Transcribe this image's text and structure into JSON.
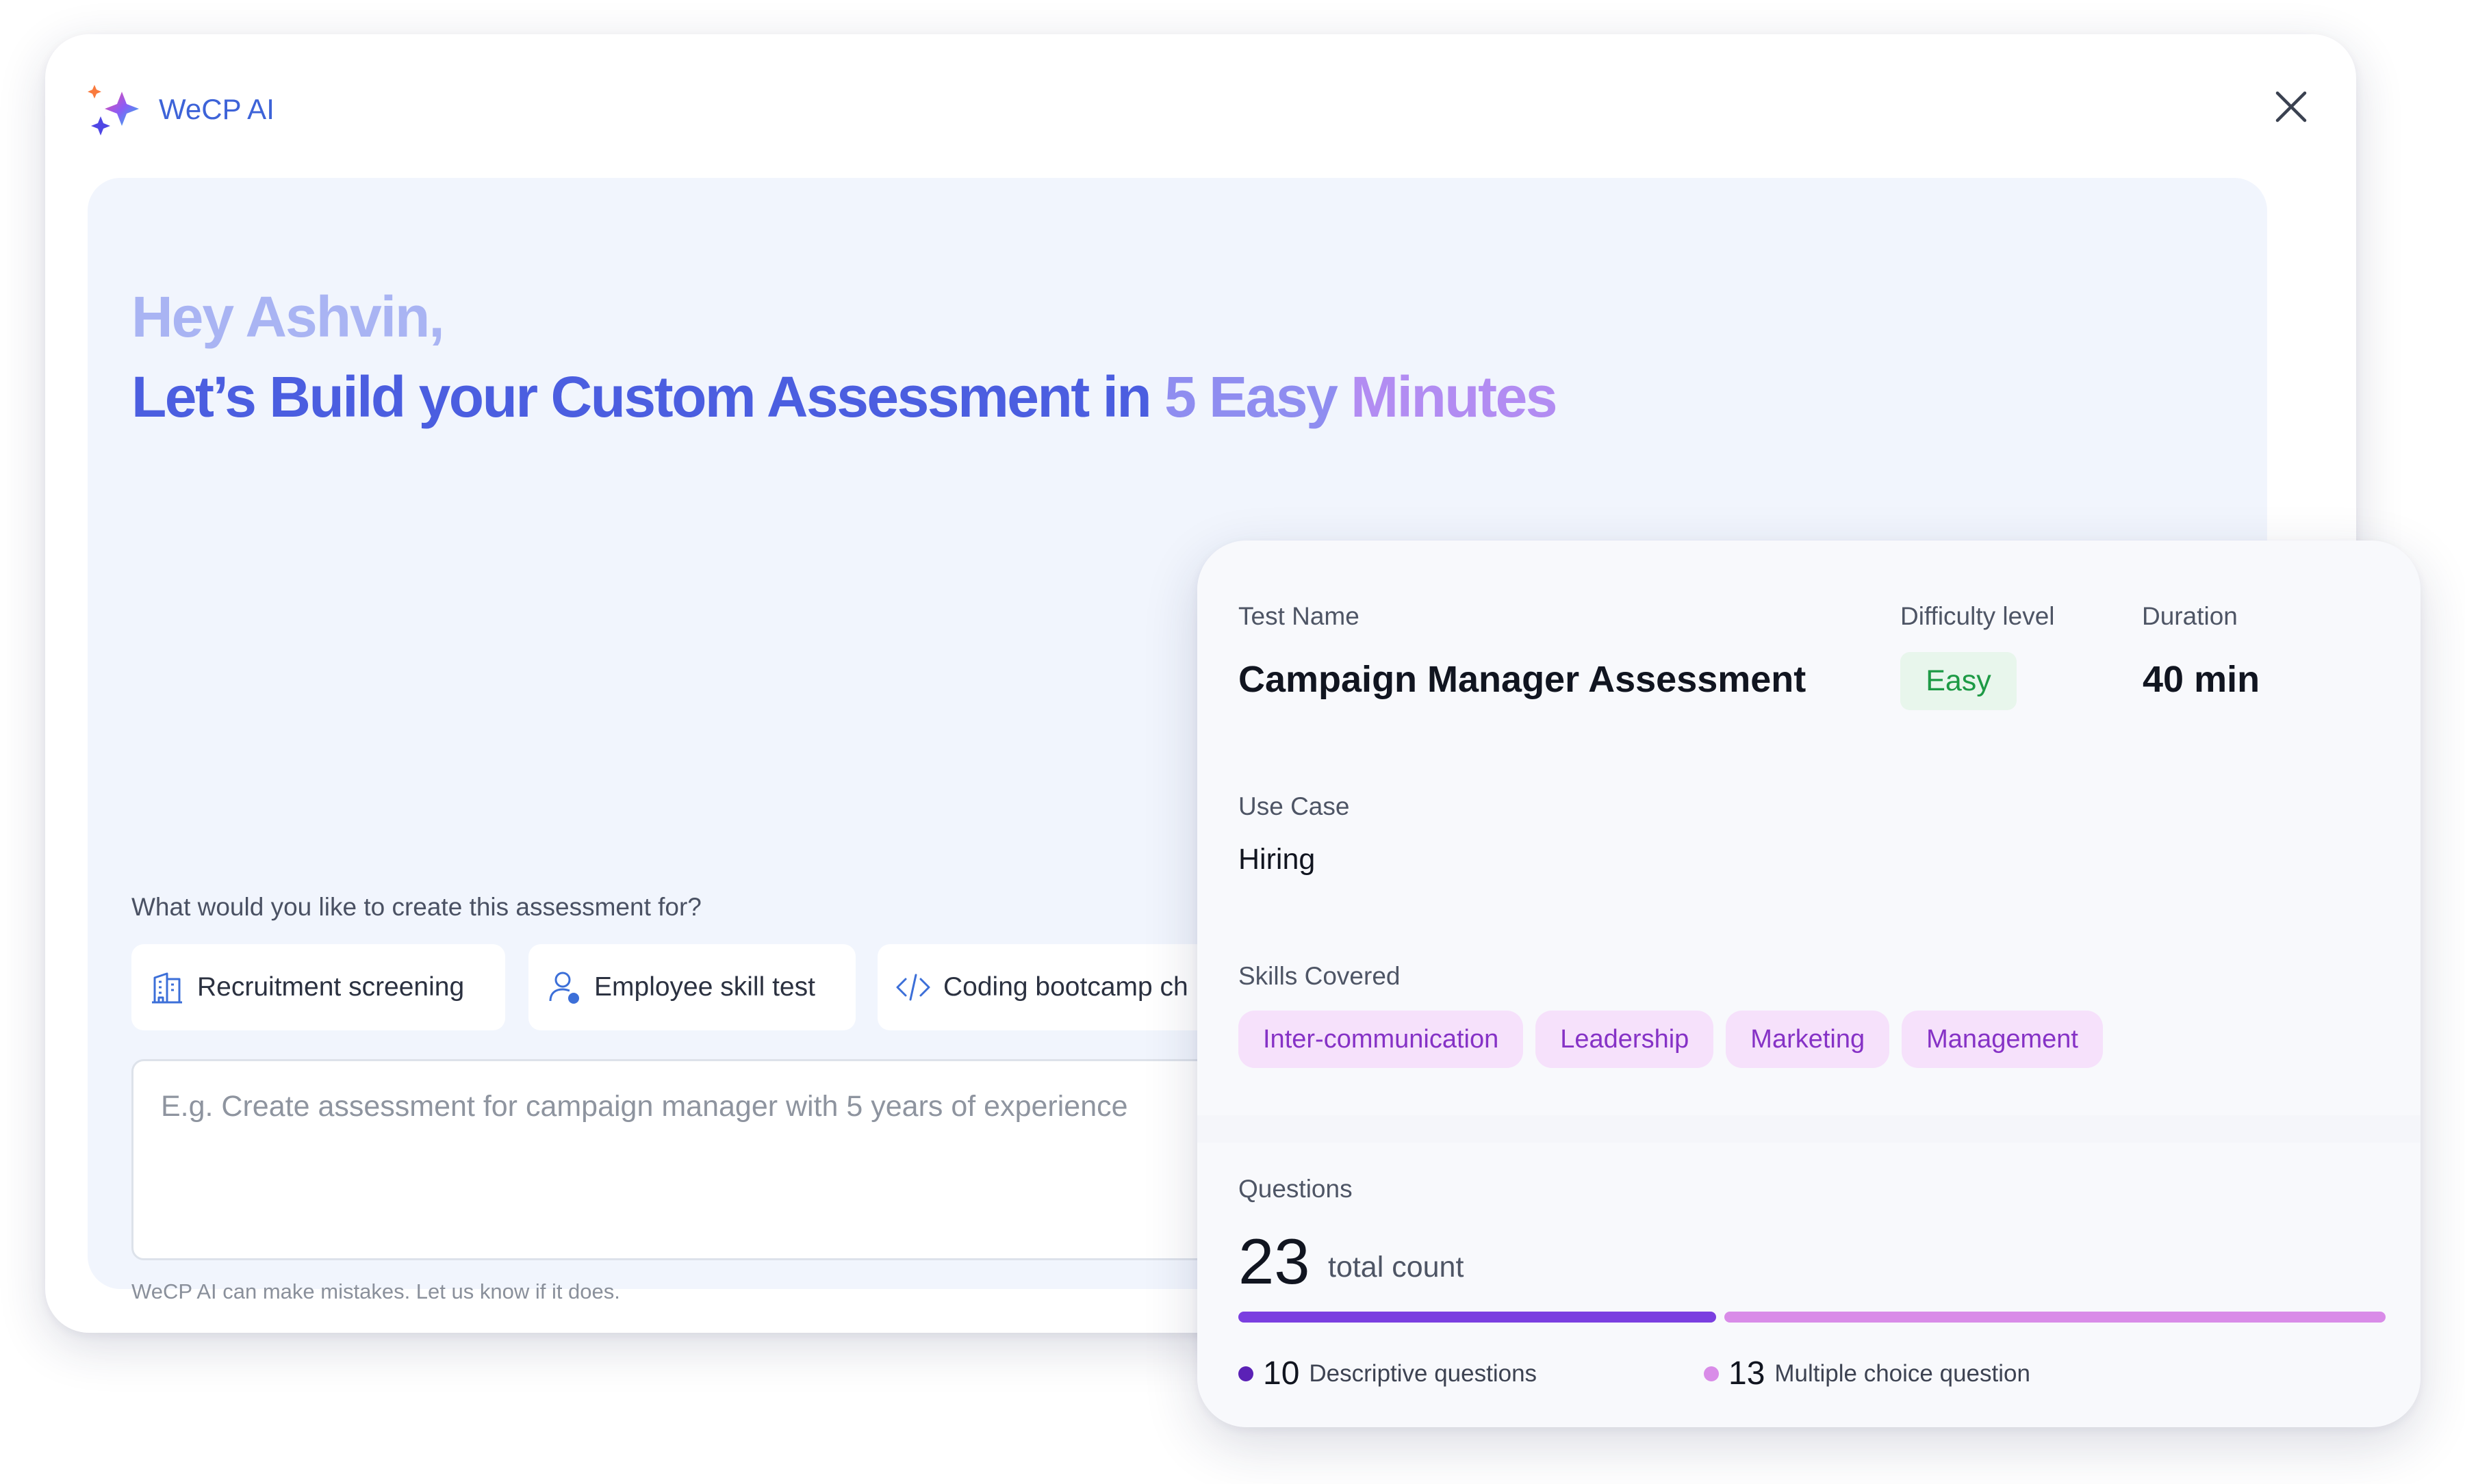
{
  "app": {
    "brand_name": "WeCP AI"
  },
  "hero": {
    "greeting": "Hey Ashvin,",
    "headline_part1": "Let’s Build your Custom Assessment in ",
    "headline_part2": "5 Easy ",
    "headline_part3": "Minutes"
  },
  "prompt": {
    "question": "What would you like to create this assessment for?",
    "options": [
      {
        "label": "Recruitment screening",
        "icon": "building-icon"
      },
      {
        "label": "Employee skill test",
        "icon": "user-check-icon"
      },
      {
        "label": "Coding bootcamp ch",
        "icon": "code-icon"
      }
    ],
    "input_placeholder": "E.g. Create assessment for campaign manager with 5 years of experience",
    "disclaimer": "WeCP AI can make mistakes. Let us know if it does."
  },
  "summary": {
    "test_name_label": "Test Name",
    "test_name": "Campaign Manager Assessment",
    "difficulty_label": "Difficulty level",
    "difficulty": "Easy",
    "duration_label": "Duration",
    "duration": "40 min",
    "use_case_label": "Use Case",
    "use_case": "Hiring",
    "skills_label": "Skills Covered",
    "skills": [
      "Inter-communication",
      "Leadership",
      "Marketing",
      "Management"
    ]
  },
  "questions": {
    "label": "Questions",
    "total": "23",
    "total_suffix": "total count",
    "descriptive_count": "10",
    "descriptive_label": "Descriptive questions",
    "mcq_count": "13",
    "mcq_label": "Multiple choice question"
  },
  "colors": {
    "accent_blue": "#4b5ee0",
    "accent_purple": "#7b3fe0",
    "accent_pink": "#d98ce8",
    "easy_green": "#1d9a45",
    "skill_text": "#8632c6"
  }
}
